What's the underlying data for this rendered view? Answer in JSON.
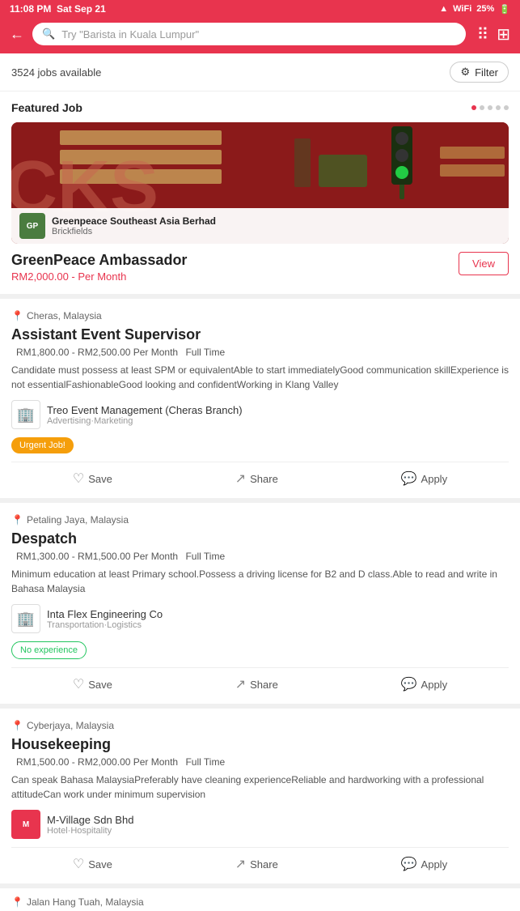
{
  "statusBar": {
    "time": "11:08 PM",
    "date": "Sat Sep 21",
    "signal": "25%",
    "battery": "🔋"
  },
  "searchBar": {
    "placeholder": "Try \"Barista in Kuala Lumpur\"",
    "backIcon": "←",
    "searchIcon": "🔍"
  },
  "jobsHeader": {
    "count": "3524 jobs available",
    "filterLabel": "Filter"
  },
  "featuredSection": {
    "label": "Featured Job",
    "dots": [
      "active",
      "inactive",
      "inactive",
      "inactive",
      "inactive"
    ],
    "company": {
      "name": "Greenpeace Southeast Asia Berhad",
      "location": "Brickfields"
    }
  },
  "featuredJob": {
    "title": "GreenPeace Ambassador",
    "salary": "RM2,000.00 - Per Month",
    "viewLabel": "View"
  },
  "jobs": [
    {
      "location": "Cheras, Malaysia",
      "title": "Assistant Event Supervisor",
      "salary": "RM1,800.00 - RM2,500.00 Per Month",
      "type": "Full Time",
      "description": "Candidate must possess at least SPM or equivalentAble to start immediatelyGood communication skillExperience is not essentialFashionableGood looking and confidentWorking in Klang Valley",
      "companyName": "Treo Event Management (Cheras Branch)",
      "companyCategory": "Advertising·Marketing",
      "badge": "Urgent Job!",
      "badgeType": "urgent",
      "saveLabel": "Save",
      "shareLabel": "Share",
      "applyLabel": "Apply"
    },
    {
      "location": "Petaling Jaya, Malaysia",
      "title": "Despatch",
      "salary": "RM1,300.00 - RM1,500.00 Per Month",
      "type": "Full Time",
      "description": "Minimum education at least Primary school.Possess a driving license for B2 and D class.Able to read and write in Bahasa Malaysia",
      "companyName": "Inta Flex Engineering Co",
      "companyCategory": "Transportation·Logistics",
      "badge": "No experience",
      "badgeType": "no-exp",
      "saveLabel": "Save",
      "shareLabel": "Share",
      "applyLabel": "Apply"
    },
    {
      "location": "Cyberjaya, Malaysia",
      "title": "Housekeeping",
      "salary": "RM1,500.00 - RM2,000.00 Per Month",
      "type": "Full Time",
      "description": "Can speak Bahasa MalaysiaPreferably have cleaning experienceReliable and hardworking with a professional attitudeCan work under minimum supervision",
      "companyName": "M-Village Sdn Bhd",
      "companyCategory": "Hotel·Hospitality",
      "badge": null,
      "badgeType": null,
      "saveLabel": "Save",
      "shareLabel": "Share",
      "applyLabel": "Apply"
    }
  ],
  "partialJob": {
    "location": "Jalan Hang Tuah, Malaysia"
  }
}
